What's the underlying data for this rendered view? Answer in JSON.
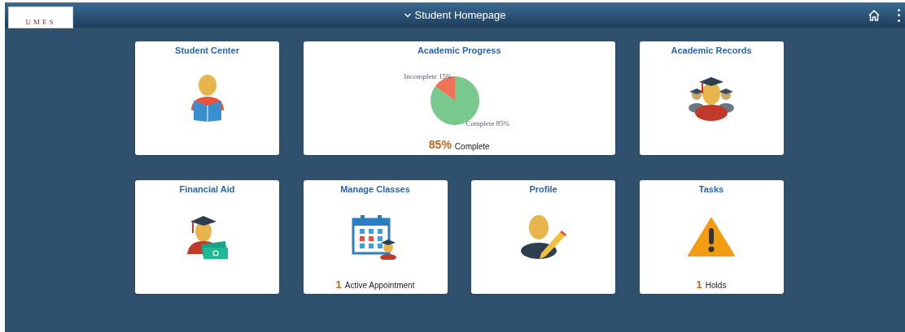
{
  "header": {
    "logo": "UMES",
    "title": "Student Homepage"
  },
  "tiles": [
    {
      "title": "Student Center",
      "kind": "student-reading"
    },
    {
      "title": "Academic Progress",
      "kind": "chart",
      "chart_data": {
        "type": "pie",
        "categories": [
          "Incomplete",
          "Complete"
        ],
        "values": [
          15,
          85
        ],
        "value_labels": [
          "15%",
          "85%"
        ]
      },
      "count": "85%",
      "count_label": "Complete"
    },
    {
      "title": "Academic Records",
      "kind": "graduates"
    },
    {
      "title": "Financial Aid",
      "kind": "graduate-money"
    },
    {
      "title": "Manage Classes",
      "kind": "calendar",
      "count": "1",
      "count_label": "Active Appointment"
    },
    {
      "title": "Profile",
      "kind": "profile-edit"
    },
    {
      "title": "Tasks",
      "kind": "warning",
      "count": "1",
      "count_label": "Holds"
    }
  ]
}
